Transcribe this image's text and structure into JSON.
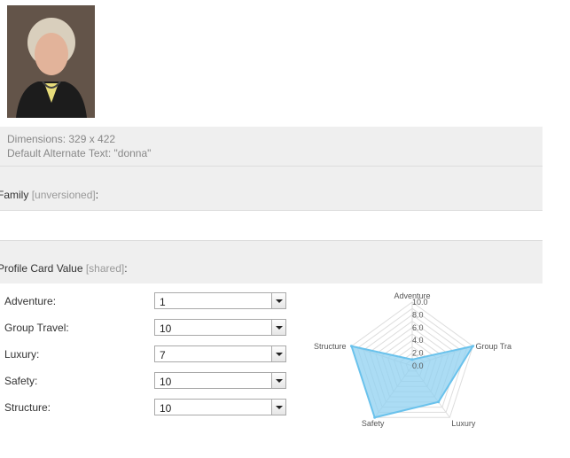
{
  "image": {
    "dimensions": "Dimensions: 329 x 422",
    "alt_text": "Default Alternate Text: \"donna\""
  },
  "family_field": {
    "label": "Family",
    "tag": "[unversioned]",
    "suffix": ":"
  },
  "profile_field": {
    "label": "Profile Card Value",
    "tag": "[shared]",
    "suffix": ":"
  },
  "ratings": [
    {
      "label": "Adventure:",
      "value": "1"
    },
    {
      "label": "Group Travel:",
      "value": "10"
    },
    {
      "label": "Luxury:",
      "value": "7"
    },
    {
      "label": "Safety:",
      "value": "10"
    },
    {
      "label": "Structure:",
      "value": "10"
    }
  ],
  "chart_data": {
    "type": "radar",
    "axes": [
      "Adventure",
      "Group Tra",
      "Luxury",
      "Safety",
      "Structure"
    ],
    "values": [
      1,
      10,
      7,
      10,
      10
    ],
    "rlim": [
      0,
      10
    ],
    "ticks": [
      "0.0",
      "2.0",
      "4.0",
      "6.0",
      "8.0",
      "10.0"
    ],
    "fill_color": "#8fd0f0",
    "stroke_color": "#6ac2ec"
  }
}
